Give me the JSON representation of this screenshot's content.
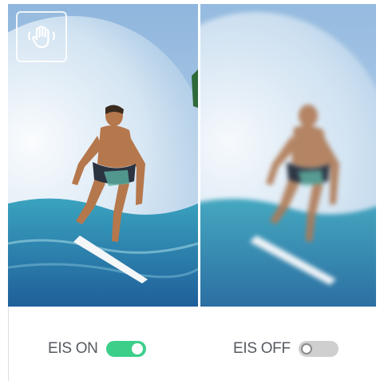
{
  "comparison": {
    "left": {
      "label": "EIS ON",
      "toggle_state": "on",
      "image_subject": "surfer-riding-wave-sharp"
    },
    "right": {
      "label": "EIS OFF",
      "toggle_state": "off",
      "image_subject": "surfer-riding-wave-blurred"
    }
  },
  "icons": {
    "gesture": "hand-gesture-icon"
  },
  "colors": {
    "toggle_on": "#3ccf8a",
    "toggle_off": "#cfcfcf",
    "label_text": "#555a60",
    "sky": "#9fc4e6",
    "wave": "#2e8fb0"
  }
}
